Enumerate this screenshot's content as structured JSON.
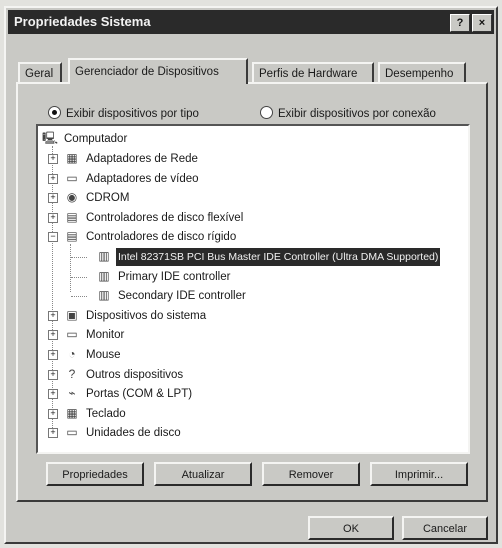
{
  "window": {
    "title": "Propriedades Sistema",
    "help_label": "?",
    "close_label": "×"
  },
  "tabs": [
    {
      "label": "Geral",
      "active": false
    },
    {
      "label": "Gerenciador de Dispositivos",
      "active": true
    },
    {
      "label": "Perfis de Hardware",
      "active": false
    },
    {
      "label": "Desempenho",
      "active": false
    }
  ],
  "view_options": [
    {
      "label": "Exibir dispositivos por tipo",
      "selected": true
    },
    {
      "label": "Exibir dispositivos por conexão",
      "selected": false
    }
  ],
  "tree": {
    "root": "Computador",
    "items": [
      {
        "label": "Adaptadores de Rede",
        "expander": "+",
        "icon": "network-icon"
      },
      {
        "label": "Adaptadores de vídeo",
        "expander": "+",
        "icon": "monitor-icon"
      },
      {
        "label": "CDROM",
        "expander": "+",
        "icon": "cdrom-icon"
      },
      {
        "label": "Controladores de disco flexível",
        "expander": "+",
        "icon": "floppy-controller-icon"
      },
      {
        "label": "Controladores de disco rígido",
        "expander": "−",
        "icon": "disk-controller-icon"
      },
      {
        "label": "Intel 82371SB PCI Bus Master IDE Controller (Ultra DMA Supported)",
        "child": true,
        "selected": true,
        "icon": "ide-controller-icon"
      },
      {
        "label": "Primary IDE controller",
        "child": true,
        "icon": "ide-controller-icon"
      },
      {
        "label": "Secondary IDE controller",
        "child": true,
        "icon": "ide-controller-icon"
      },
      {
        "label": "Dispositivos do sistema",
        "expander": "+",
        "icon": "system-device-icon"
      },
      {
        "label": "Monitor",
        "expander": "+",
        "icon": "monitor-icon"
      },
      {
        "label": "Mouse",
        "expander": "+",
        "icon": "mouse-icon"
      },
      {
        "label": "Outros dispositivos",
        "expander": "+",
        "icon": "question-icon"
      },
      {
        "label": "Portas (COM & LPT)",
        "expander": "+",
        "icon": "port-icon"
      },
      {
        "label": "Teclado",
        "expander": "+",
        "icon": "keyboard-icon"
      },
      {
        "label": "Unidades de disco",
        "expander": "+",
        "icon": "disk-drive-icon"
      }
    ]
  },
  "actions": {
    "properties": "Propriedades",
    "refresh": "Atualizar",
    "remove": "Remover",
    "print": "Imprimir..."
  },
  "dialog": {
    "ok": "OK",
    "cancel": "Cancelar"
  },
  "colors": {
    "selection": "#2a2a2a",
    "face": "#c9c9c5"
  }
}
